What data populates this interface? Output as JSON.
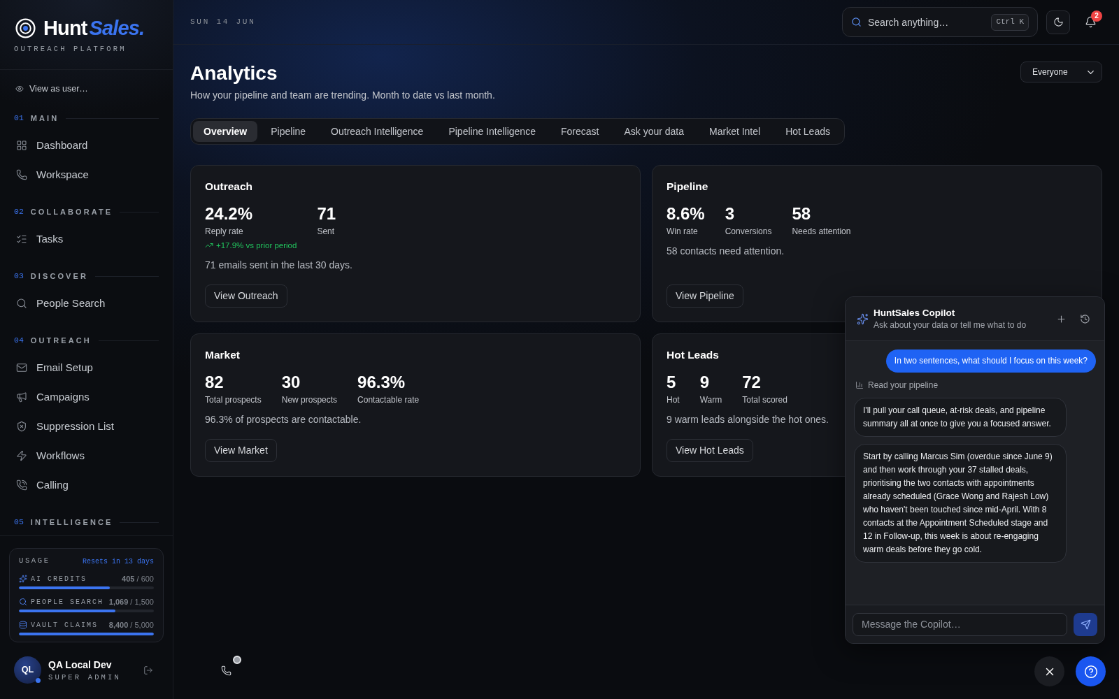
{
  "sidebar": {
    "brand": {
      "name": "Hunt",
      "accent": "Sales.",
      "tagline": "OUTREACH PLATFORM"
    },
    "view_as": "View as user…",
    "sections": [
      {
        "number": "01",
        "title": "MAIN",
        "items": [
          {
            "label": "Dashboard"
          },
          {
            "label": "Workspace"
          }
        ]
      },
      {
        "number": "02",
        "title": "COLLABORATE",
        "items": [
          {
            "label": "Tasks"
          }
        ]
      },
      {
        "number": "03",
        "title": "DISCOVER",
        "items": [
          {
            "label": "People Search"
          }
        ]
      },
      {
        "number": "04",
        "title": "OUTREACH",
        "items": [
          {
            "label": "Email Setup"
          },
          {
            "label": "Campaigns"
          },
          {
            "label": "Suppression List"
          },
          {
            "label": "Workflows"
          },
          {
            "label": "Calling"
          }
        ]
      },
      {
        "number": "05",
        "title": "INTELLIGENCE"
      }
    ],
    "usage": {
      "title": "USAGE",
      "reset_note": "Resets in 13 days",
      "meters": [
        {
          "label": "AI CREDITS",
          "reading": "**405** / 600",
          "level": 0.675
        },
        {
          "label": "PEOPLE SEARCH",
          "reading": "**1,069** / 1,500",
          "level": 0.713
        },
        {
          "label": "VAULT CLAIMS",
          "reading": "**8,400** / 5,000",
          "level": 1
        }
      ]
    },
    "user": {
      "initials": "QL",
      "name": "QA Local Dev",
      "role": "SUPER ADMIN"
    }
  },
  "header": {
    "date": "SUN 14 JUN",
    "search": {
      "placeholder": "Search anything…",
      "shortcut": "Ctrl K"
    },
    "notifications": "2"
  },
  "page": {
    "title": "Analytics",
    "subtitle": "How your pipeline and team are trending. Month to date vs last month.",
    "filter": {
      "value": "Everyone"
    },
    "tabs": [
      {
        "label": "Overview",
        "selected": true
      },
      {
        "label": "Pipeline",
        "selected": false
      },
      {
        "label": "Outreach Intelligence",
        "selected": false
      },
      {
        "label": "Pipeline Intelligence",
        "selected": false
      },
      {
        "label": "Forecast",
        "selected": false
      },
      {
        "label": "Ask your data",
        "selected": false
      },
      {
        "label": "Market Intel",
        "selected": false
      },
      {
        "label": "Hot Leads",
        "selected": false
      }
    ]
  },
  "cards": [
    {
      "title": "Outreach",
      "stats": [
        {
          "value": "24.2%",
          "label": "Reply rate",
          "trend": "+17.9% vs prior period"
        },
        {
          "value": "71",
          "label": "Sent"
        }
      ],
      "description": "71 emails sent in the last 30 days.",
      "button": "View Outreach"
    },
    {
      "title": "Pipeline",
      "stats": [
        {
          "value": "8.6%",
          "label": "Win rate"
        },
        {
          "value": "3",
          "label": "Conversions"
        },
        {
          "value": "58",
          "label": "Needs attention"
        }
      ],
      "description": "58 contacts need attention.",
      "button": "View Pipeline"
    },
    {
      "title": "Market",
      "stats": [
        {
          "value": "82",
          "label": "Total prospects"
        },
        {
          "value": "30",
          "label": "New prospects"
        },
        {
          "value": "96.3%",
          "label": "Contactable rate"
        }
      ],
      "description": "96.3% of prospects are contactable.",
      "button": "View Market"
    },
    {
      "title": "Hot Leads",
      "stats": [
        {
          "value": "5",
          "label": "Hot"
        },
        {
          "value": "9",
          "label": "Warm"
        },
        {
          "value": "72",
          "label": "Total scored"
        }
      ],
      "description": "9 warm leads alongside the hot ones.",
      "button": "View Hot Leads"
    }
  ],
  "copilot": {
    "title": "HuntSales Copilot",
    "subtitle": "Ask about your data or tell me what to do",
    "messages": [
      {
        "kind": "user",
        "text": "In two sentences, what should I focus on this week?"
      },
      {
        "kind": "status",
        "text": "Read your pipeline"
      },
      {
        "kind": "assistant",
        "text": "I'll pull your call queue, at-risk deals, and pipeline summary all at once to give you a focused answer."
      },
      {
        "kind": "assistant",
        "text": "Start by calling Marcus Sim (overdue since June 9) and then work through your 37 stalled deals, prioritising the two contacts with appointments already scheduled (Grace Wong and Rajesh Low) who haven't been touched since mid-April. With 8 contacts at the Appointment Scheduled stage and 12 in Follow-up, this week is about re-engaging warm deals before they go cold."
      }
    ],
    "input": {
      "placeholder": "Message the Copilot…"
    }
  }
}
